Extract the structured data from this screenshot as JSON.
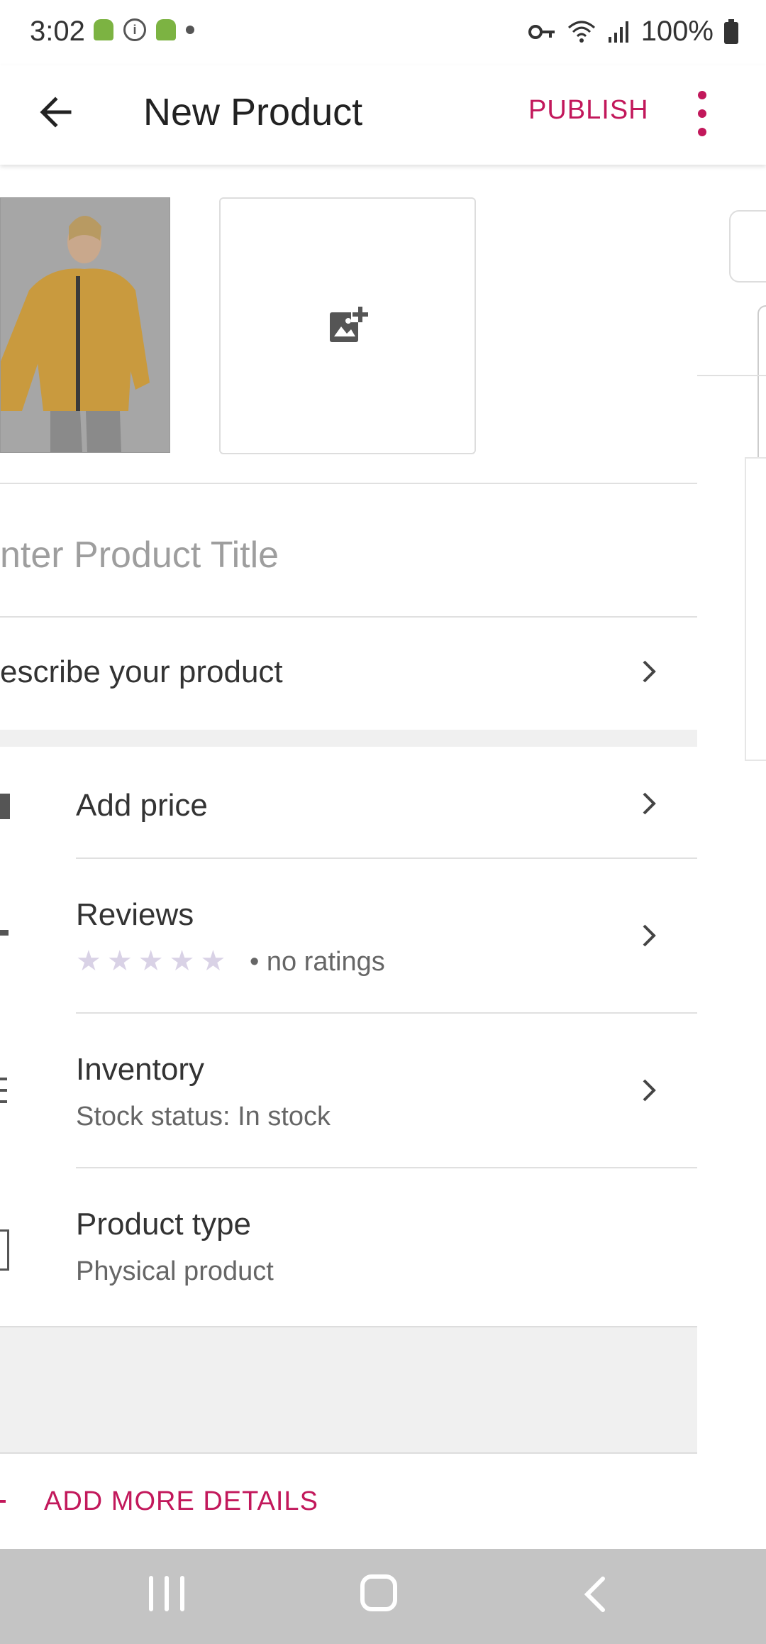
{
  "status_bar": {
    "time": "3:02",
    "battery": "100%"
  },
  "app_bar": {
    "title": "New Product",
    "publish_label": "PUBLISH"
  },
  "form": {
    "title_placeholder": "nter Product Title",
    "describe_label": "escribe your product"
  },
  "settings": {
    "price": {
      "title": "Add price"
    },
    "reviews": {
      "title": "Reviews",
      "rating_text": "• no ratings",
      "stars": 5,
      "rating_value": 0
    },
    "inventory": {
      "title": "Inventory",
      "subtitle": "Stock status: In stock"
    },
    "product_type": {
      "title": "Product type",
      "subtitle": "Physical product"
    }
  },
  "add_more_label": "ADD MORE DETAILS",
  "colors": {
    "accent": "#c2185b",
    "star": "#d9d2e6",
    "divider": "#e0e0e0",
    "band": "#f0f0f0"
  },
  "icons": [
    "back-arrow-icon",
    "more-vert-icon",
    "add-photo-icon",
    "chevron-right-icon",
    "star-icon",
    "android-icon",
    "info-icon",
    "key-icon",
    "wifi-icon",
    "signal-icon",
    "battery-icon"
  ]
}
